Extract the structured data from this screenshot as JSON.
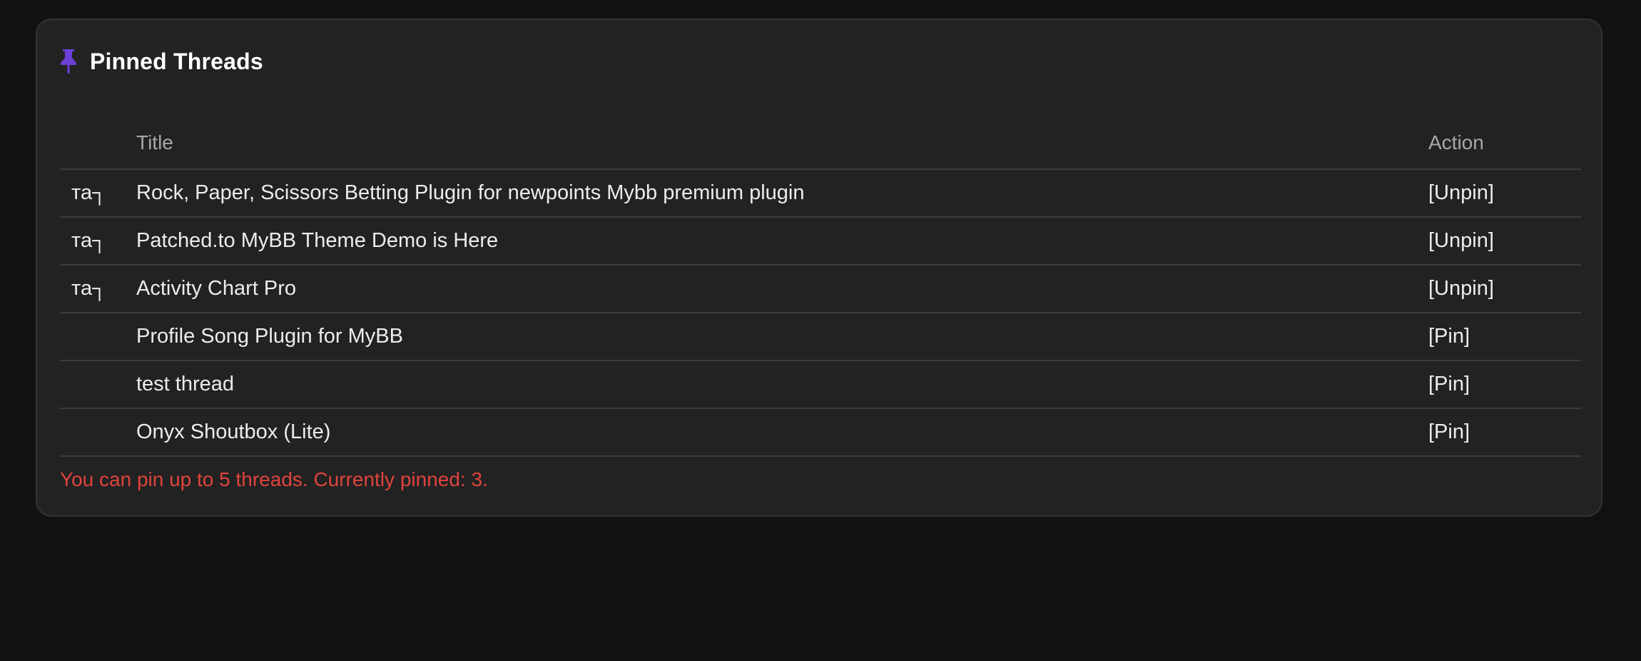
{
  "panel": {
    "title": "Pinned Threads",
    "icon": "pushpin-icon",
    "icon_color": "#6c3fd6"
  },
  "table": {
    "columns": {
      "badge": "",
      "title": "Title",
      "action": "Action"
    },
    "rows": [
      {
        "badge": "та┐",
        "title": "Rock, Paper, Scissors Betting Plugin for newpoints Mybb premium plugin",
        "action": "[Unpin]"
      },
      {
        "badge": "та┐",
        "title": "Patched.to MyBB Theme Demo is Here",
        "action": "[Unpin]"
      },
      {
        "badge": "та┐",
        "title": "Activity Chart Pro",
        "action": "[Unpin]"
      },
      {
        "badge": "",
        "title": "Profile Song Plugin for MyBB",
        "action": "[Pin]"
      },
      {
        "badge": "",
        "title": "test thread",
        "action": "[Pin]"
      },
      {
        "badge": "",
        "title": "Onyx Shoutbox (Lite)",
        "action": "[Pin]"
      }
    ]
  },
  "notice": {
    "text": "You can pin up to 5 threads. Currently pinned: 3.",
    "color": "#e0433d"
  }
}
